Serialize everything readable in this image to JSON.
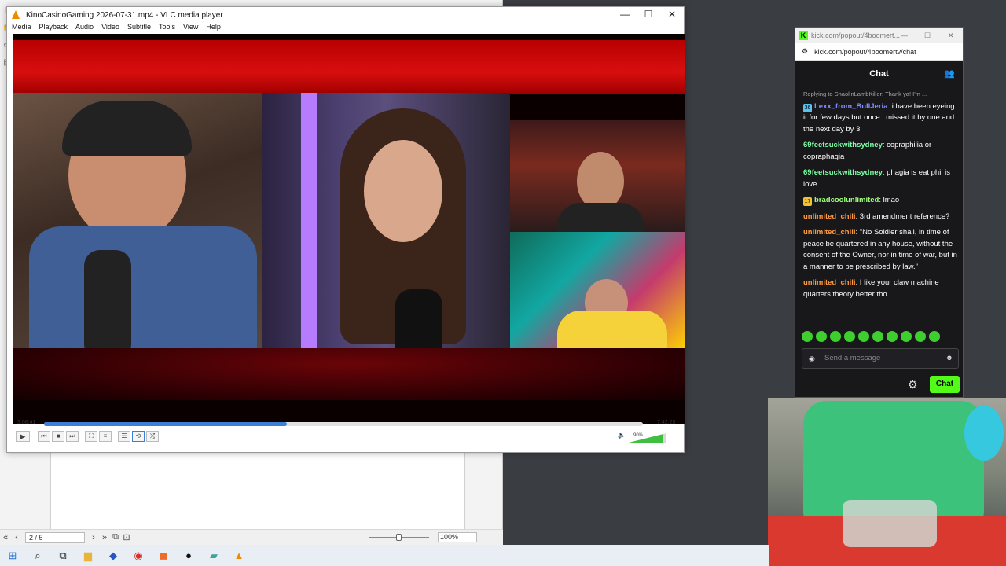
{
  "background_app": {
    "status": {
      "page": "2 / 5",
      "zoom": "100%"
    }
  },
  "vlc": {
    "title": "KinoCasinoGaming 2026-07-31.mp4 - VLC media player",
    "menu": [
      "Media",
      "Playback",
      "Audio",
      "Video",
      "Subtitle",
      "Tools",
      "View",
      "Help"
    ],
    "time_current": "3:08:41",
    "time_total": "7:42:25",
    "progress_fraction": 0.405,
    "volume": "90%"
  },
  "kick": {
    "window_title": "kick.com/popout/4boomert...",
    "url": "kick.com/popout/4boomertv/chat",
    "header": "Chat",
    "messages": [
      {
        "reply": "Replying to ShaolinLambKiller: Thank ya! I'm ...",
        "badge": "36",
        "user": "Lexx_from_BullJeria",
        "text": "i have been eyeing it for few days but once i missed it by one and the next day by 3",
        "color": "#7f8cff"
      },
      {
        "user": "69feetsuckwithsydney",
        "text": "copraphilia or copraphagia",
        "color": "#7dffa6"
      },
      {
        "user": "69feetsuckwithsydney",
        "text": "phagia is eat phil is love",
        "color": "#7dffa6"
      },
      {
        "badge": "17",
        "user": "bradcoolunlimited",
        "text": "lmao",
        "color": "#9cff7a"
      },
      {
        "user": "unlimited_chili",
        "text": "3rd amendment reference?",
        "color": "#ff9a3c"
      },
      {
        "user": "unlimited_chili",
        "text": "\"No Soldier shall, in time of peace be quartered in any house, without the consent of the Owner, nor in time of war, but in a manner to be prescribed by law.\"",
        "color": "#ff9a3c"
      },
      {
        "user": "unlimited_chili",
        "text": "I like your claw machine quarters theory better tho",
        "color": "#ff9a3c"
      }
    ],
    "input_placeholder": "Send a message",
    "send_label": "Chat"
  }
}
